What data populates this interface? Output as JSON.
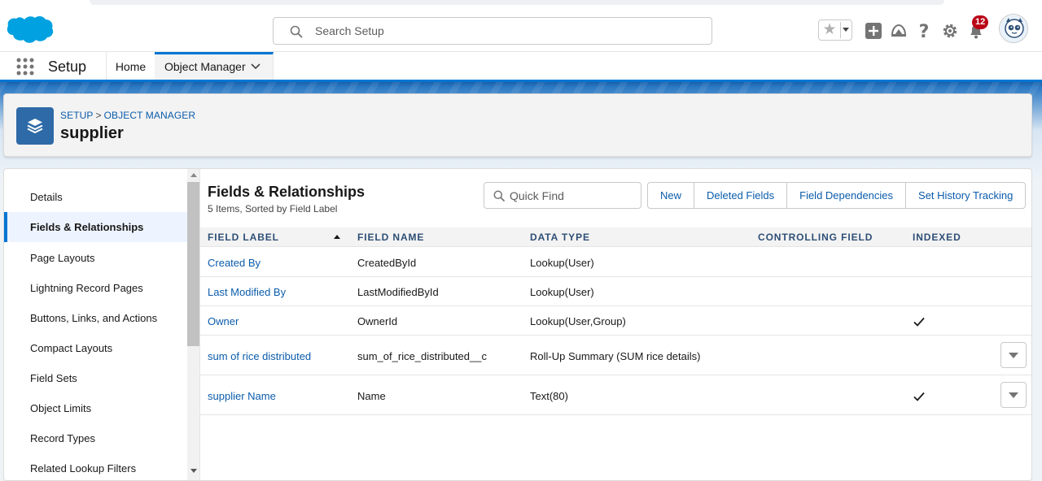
{
  "header": {
    "search_placeholder": "Search Setup",
    "notification_count": "12",
    "icons": [
      "star-icon",
      "chevron-down-icon",
      "add-icon",
      "trailhead-icon",
      "help-icon",
      "gear-icon",
      "bell-icon",
      "avatar"
    ]
  },
  "context_bar": {
    "app_name": "Setup",
    "tabs": [
      {
        "label": "Home"
      },
      {
        "label": "Object Manager"
      }
    ]
  },
  "page_header": {
    "breadcrumb": [
      "SETUP",
      "OBJECT MANAGER"
    ],
    "breadcrumb_separator": ">",
    "title": "supplier"
  },
  "sidebar": {
    "items": [
      {
        "label": "Details"
      },
      {
        "label": "Fields & Relationships"
      },
      {
        "label": "Page Layouts"
      },
      {
        "label": "Lightning Record Pages"
      },
      {
        "label": "Buttons, Links, and Actions"
      },
      {
        "label": "Compact Layouts"
      },
      {
        "label": "Field Sets"
      },
      {
        "label": "Object Limits"
      },
      {
        "label": "Record Types"
      },
      {
        "label": "Related Lookup Filters"
      }
    ],
    "active_item": "Fields & Relationships"
  },
  "content": {
    "title": "Fields & Relationships",
    "subtitle": "5 Items, Sorted by Field Label",
    "quick_find_placeholder": "Quick Find",
    "buttons": [
      "New",
      "Deleted Fields",
      "Field Dependencies",
      "Set History Tracking"
    ],
    "columns": [
      "FIELD LABEL",
      "FIELD NAME",
      "DATA TYPE",
      "CONTROLLING FIELD",
      "INDEXED"
    ],
    "rows": [
      {
        "label": "Created By",
        "name": "CreatedById",
        "type": "Lookup(User)",
        "controlling": "",
        "indexed": false,
        "menu": false
      },
      {
        "label": "Last Modified By",
        "name": "LastModifiedById",
        "type": "Lookup(User)",
        "controlling": "",
        "indexed": false,
        "menu": false
      },
      {
        "label": "Owner",
        "name": "OwnerId",
        "type": "Lookup(User,Group)",
        "controlling": "",
        "indexed": true,
        "menu": false
      },
      {
        "label": "sum of rice distributed",
        "name": "sum_of_rice_distributed__c",
        "type": "Roll-Up Summary (SUM rice details)",
        "controlling": "",
        "indexed": false,
        "menu": true
      },
      {
        "label": "supplier Name",
        "name": "Name",
        "type": "Text(80)",
        "controlling": "",
        "indexed": true,
        "menu": true
      }
    ]
  },
  "colors": {
    "brand_blue": "#0176d3",
    "link_blue": "#0b5cab",
    "header_text": "#2e4f76",
    "notification_red": "#ba0517",
    "object_icon_bg": "#2e6aa7"
  }
}
